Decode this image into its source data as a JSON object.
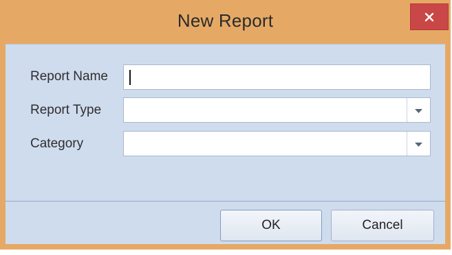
{
  "window": {
    "title": "New Report",
    "close_icon": "close-icon"
  },
  "form": {
    "report_name": {
      "label": "Report Name",
      "value": ""
    },
    "report_type": {
      "label": "Report Type",
      "value": "",
      "dropdown_icon": "chevron-down-icon"
    },
    "category": {
      "label": "Category",
      "value": "",
      "dropdown_icon": "chevron-down-icon"
    }
  },
  "buttons": {
    "ok": "OK",
    "cancel": "Cancel"
  },
  "colors": {
    "title_bar": "#e6a965",
    "close_button": "#c94747",
    "client_area": "#cfdcee"
  }
}
